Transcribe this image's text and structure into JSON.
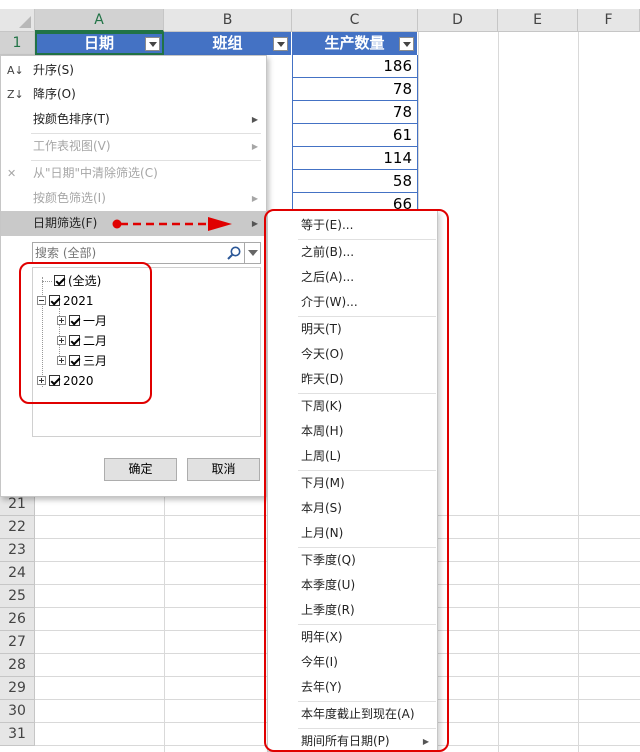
{
  "sheet": {
    "columns": [
      "A",
      "B",
      "C",
      "D",
      "E",
      "F"
    ],
    "header_row_number": "1",
    "row_numbers": [
      "21",
      "22",
      "23",
      "24",
      "25",
      "26",
      "27",
      "28",
      "29",
      "30",
      "31"
    ],
    "headers": [
      "日期",
      "班组",
      "生产数量"
    ],
    "quantities": [
      "186",
      "78",
      "78",
      "61",
      "114",
      "58",
      "66"
    ]
  },
  "filter_menu": {
    "sort_asc": "升序(S)",
    "sort_desc": "降序(O)",
    "sort_by_color": "按颜色排序(T)",
    "sheet_view": "工作表视图(V)",
    "clear_filter": "从\"日期\"中清除筛选(C)",
    "filter_by_color": "按颜色筛选(I)",
    "date_filters": "日期筛选(F)",
    "search_placeholder": "搜索 (全部)",
    "tree": {
      "select_all": "(全选)",
      "year_2021": "2021",
      "jan": "一月",
      "feb": "二月",
      "mar": "三月",
      "year_2020": "2020"
    },
    "ok_label": "确定",
    "cancel_label": "取消"
  },
  "date_submenu": {
    "items": [
      "等于(E)...",
      "之前(B)...",
      "之后(A)...",
      "介于(W)...",
      "明天(T)",
      "今天(O)",
      "昨天(D)",
      "下周(K)",
      "本周(H)",
      "上周(L)",
      "下月(M)",
      "本月(S)",
      "上月(N)",
      "下季度(Q)",
      "本季度(U)",
      "上季度(R)",
      "明年(X)",
      "今年(I)",
      "去年(Y)",
      "本年度截止到现在(A)",
      "期间所有日期(P)"
    ]
  },
  "colors": {
    "header_fill": "#4472c4",
    "annotation": "#e00000",
    "excel_green": "#217346",
    "highlight": "#c9c9c9"
  }
}
